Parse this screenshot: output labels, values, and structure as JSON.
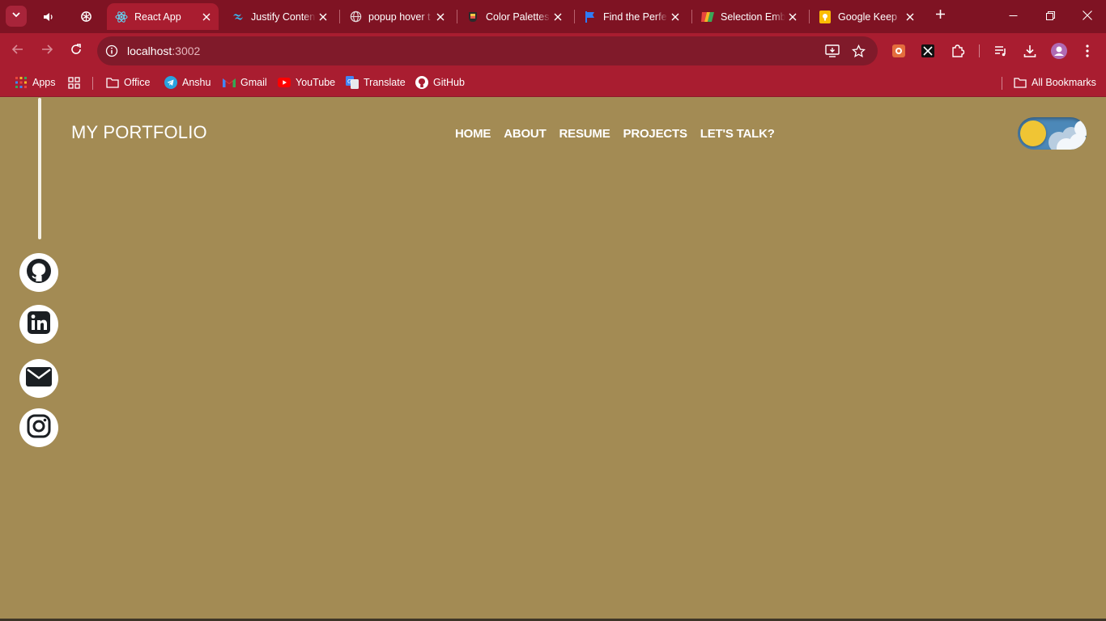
{
  "browser": {
    "tabs": [
      {
        "title": "",
        "icon": "speaker-icon"
      },
      {
        "title": "",
        "icon": "chatgpt-icon"
      },
      {
        "title": "React App",
        "icon": "react-icon",
        "active": true
      },
      {
        "title": "Justify Content",
        "icon": "tailwind-icon"
      },
      {
        "title": "popup hover t",
        "icon": "globe-icon"
      },
      {
        "title": "Color Palettes",
        "icon": "palette-icon"
      },
      {
        "title": "Find the Perfe",
        "icon": "flag-icon"
      },
      {
        "title": "Selection Emb",
        "icon": "brand-icon"
      },
      {
        "title": "Google Keep",
        "icon": "keep-icon"
      }
    ],
    "address": {
      "host": "localhost",
      "port": ":3002"
    },
    "bookmarks": [
      {
        "label": "Apps",
        "icon": "apps-grid-icon"
      },
      {
        "label": "Office",
        "icon": "folder-icon"
      },
      {
        "label": "Anshu",
        "icon": "telegram-icon"
      },
      {
        "label": "Gmail",
        "icon": "gmail-icon"
      },
      {
        "label": "YouTube",
        "icon": "youtube-icon"
      },
      {
        "label": "Translate",
        "icon": "translate-icon"
      },
      {
        "label": "GitHub",
        "icon": "github-icon"
      }
    ],
    "all_bookmarks": "All Bookmarks"
  },
  "page": {
    "brand": "MY PORTFOLIO",
    "nav": [
      "HOME",
      "ABOUT",
      "RESUME",
      "PROJECTS",
      "LET'S TALK?"
    ],
    "theme_toggle": {
      "state": "light",
      "icon": "sun-icon"
    },
    "social": [
      {
        "name": "github",
        "icon": "github-icon"
      },
      {
        "name": "linkedin",
        "icon": "linkedin-icon"
      },
      {
        "name": "email",
        "icon": "mail-icon"
      },
      {
        "name": "instagram",
        "icon": "instagram-icon"
      }
    ]
  },
  "colors": {
    "tabstrip": "#7f1323",
    "toolbar": "#a91d30",
    "omnibox": "#801a2a",
    "page_bg": "#a38b54",
    "sun": "#f0c534",
    "toggle_sky": "#4c88b8"
  }
}
